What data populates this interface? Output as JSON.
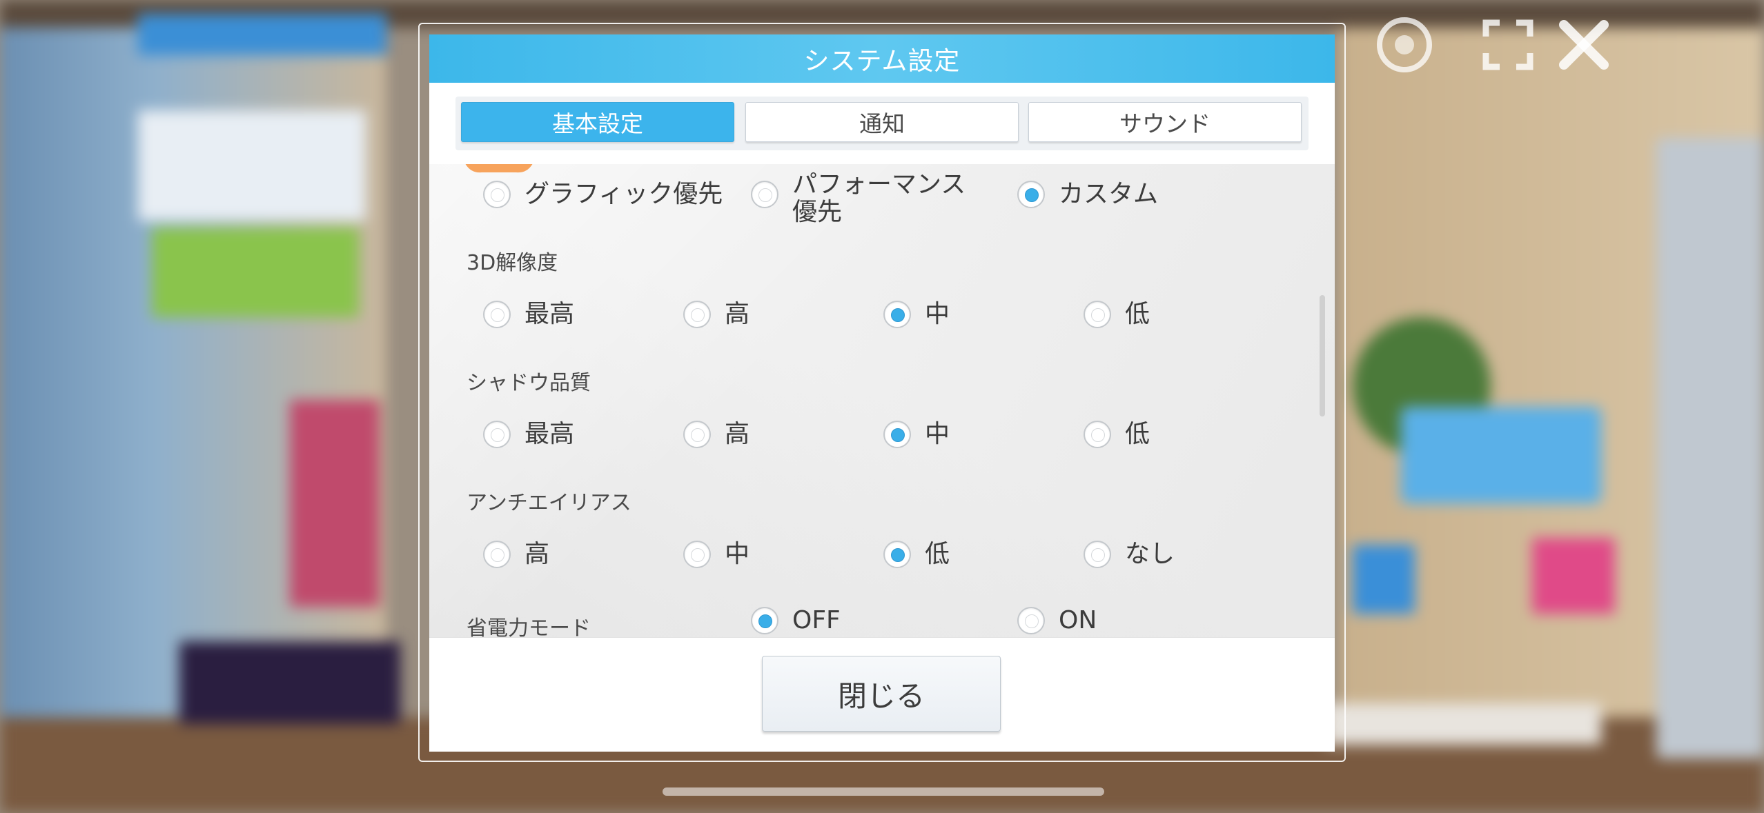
{
  "dialog": {
    "title": "システム設定",
    "tabs": [
      {
        "label": "基本設定",
        "active": true
      },
      {
        "label": "通知",
        "active": false
      },
      {
        "label": "サウンド",
        "active": false
      }
    ],
    "close_label": "閉じる"
  },
  "quality_preset": {
    "options": [
      {
        "label": "グラフィック優先",
        "checked": false
      },
      {
        "label": "パフォーマンス\n優先",
        "checked": false
      },
      {
        "label": "カスタム",
        "checked": true
      }
    ]
  },
  "resolution_3d": {
    "label": "3D解像度",
    "options": [
      {
        "label": "最高",
        "checked": false
      },
      {
        "label": "高",
        "checked": false
      },
      {
        "label": "中",
        "checked": true
      },
      {
        "label": "低",
        "checked": false
      }
    ]
  },
  "shadow_quality": {
    "label": "シャドウ品質",
    "options": [
      {
        "label": "最高",
        "checked": false
      },
      {
        "label": "高",
        "checked": false
      },
      {
        "label": "中",
        "checked": true
      },
      {
        "label": "低",
        "checked": false
      }
    ]
  },
  "anti_aliasing": {
    "label": "アンチエイリアス",
    "options": [
      {
        "label": "高",
        "checked": false
      },
      {
        "label": "中",
        "checked": false
      },
      {
        "label": "低",
        "checked": true
      },
      {
        "label": "なし",
        "checked": false
      }
    ]
  },
  "power_saving": {
    "label": "省電力モード",
    "options": [
      {
        "label": "OFF",
        "checked": true
      },
      {
        "label": "ON",
        "checked": false
      }
    ]
  },
  "colors": {
    "accent": "#3cb4ec",
    "title_bar": "#3cb7ea",
    "radio_checked": "#3aaee8"
  },
  "icons": {
    "top_right": [
      "logo-badge-icon",
      "fullscreen-icon",
      "close-x-icon"
    ]
  }
}
